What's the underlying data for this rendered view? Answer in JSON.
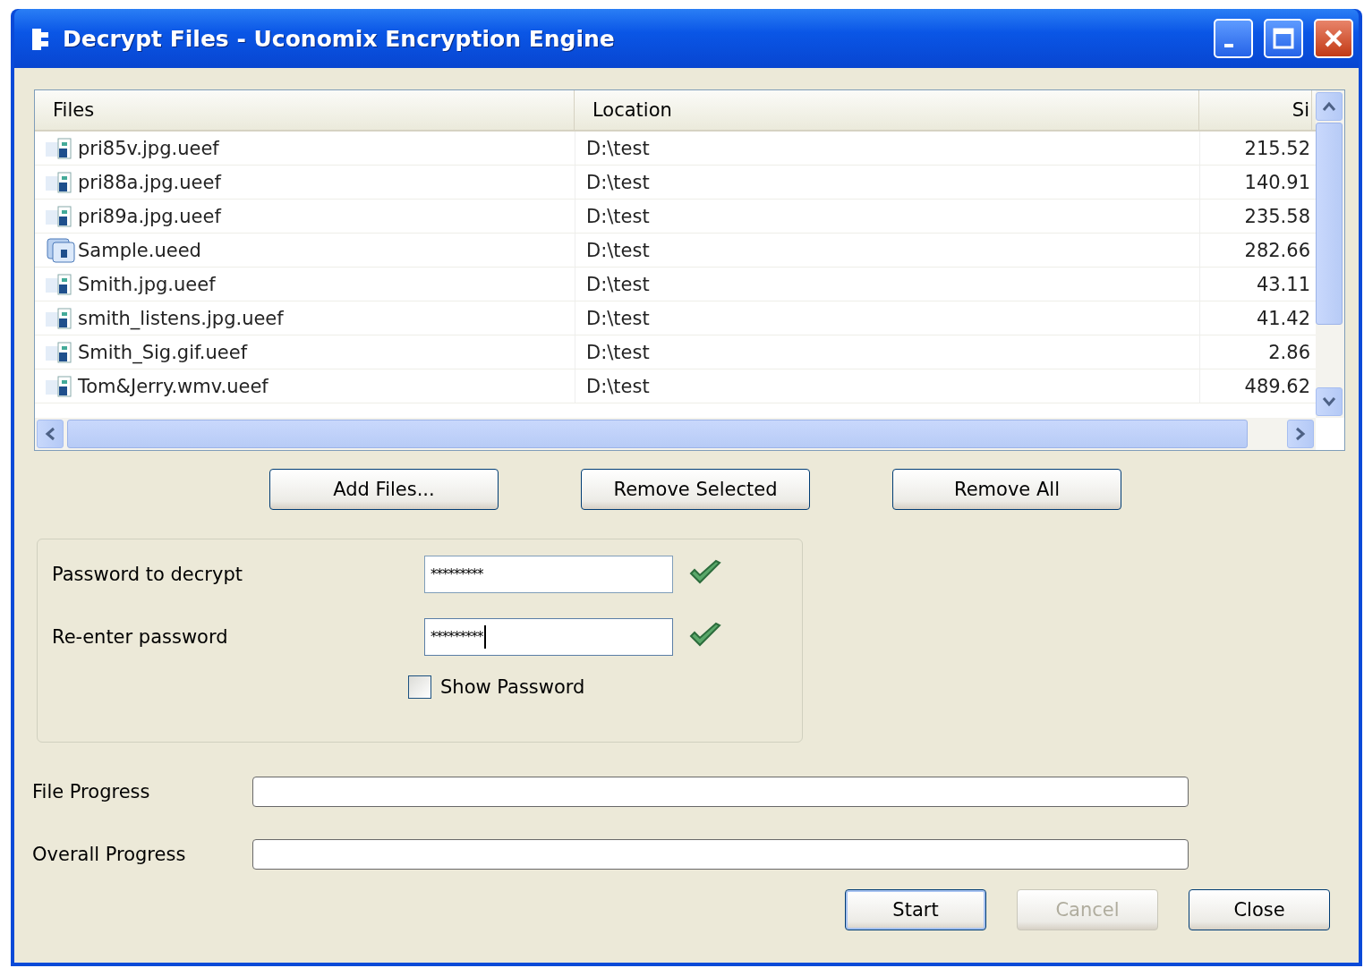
{
  "window": {
    "title": "Decrypt Files - Uconomix Encryption Engine"
  },
  "table": {
    "columns": [
      "Files",
      "Location",
      "Si"
    ],
    "rows": [
      {
        "kind": "file",
        "name": "pri85v.jpg.ueef",
        "location": "D:\\test",
        "size": "215.52"
      },
      {
        "kind": "file",
        "name": "pri88a.jpg.ueef",
        "location": "D:\\test",
        "size": "140.91"
      },
      {
        "kind": "file",
        "name": "pri89a.jpg.ueef",
        "location": "D:\\test",
        "size": "235.58"
      },
      {
        "kind": "archive",
        "name": "Sample.ueed",
        "location": "D:\\test",
        "size": "282.66"
      },
      {
        "kind": "file",
        "name": "Smith.jpg.ueef",
        "location": "D:\\test",
        "size": "43.11"
      },
      {
        "kind": "file",
        "name": "smith_listens.jpg.ueef",
        "location": "D:\\test",
        "size": "41.42"
      },
      {
        "kind": "file",
        "name": "Smith_Sig.gif.ueef",
        "location": "D:\\test",
        "size": "2.86"
      },
      {
        "kind": "file",
        "name": "Tom&Jerry.wmv.ueef",
        "location": "D:\\test",
        "size": "489.62"
      }
    ]
  },
  "list_buttons": [
    {
      "label": "Add Files..."
    },
    {
      "label": "Remove Selected"
    },
    {
      "label": "Remove All"
    }
  ],
  "password": {
    "fields": [
      {
        "label": "Password to decrypt",
        "value": "*********",
        "valid": true,
        "focused": false
      },
      {
        "label": "Re-enter password",
        "value": "*********",
        "valid": true,
        "focused": true
      }
    ],
    "show_password": {
      "label": "Show Password",
      "checked": false
    }
  },
  "progress": [
    {
      "label": "File Progress",
      "level": 0
    },
    {
      "label": "Overall Progress",
      "level": 0
    }
  ],
  "buttons": [
    {
      "label": "Start",
      "disabled": false,
      "default": true
    },
    {
      "label": "Cancel",
      "disabled": true,
      "default": false
    },
    {
      "label": "Close",
      "disabled": false,
      "default": false
    }
  ]
}
